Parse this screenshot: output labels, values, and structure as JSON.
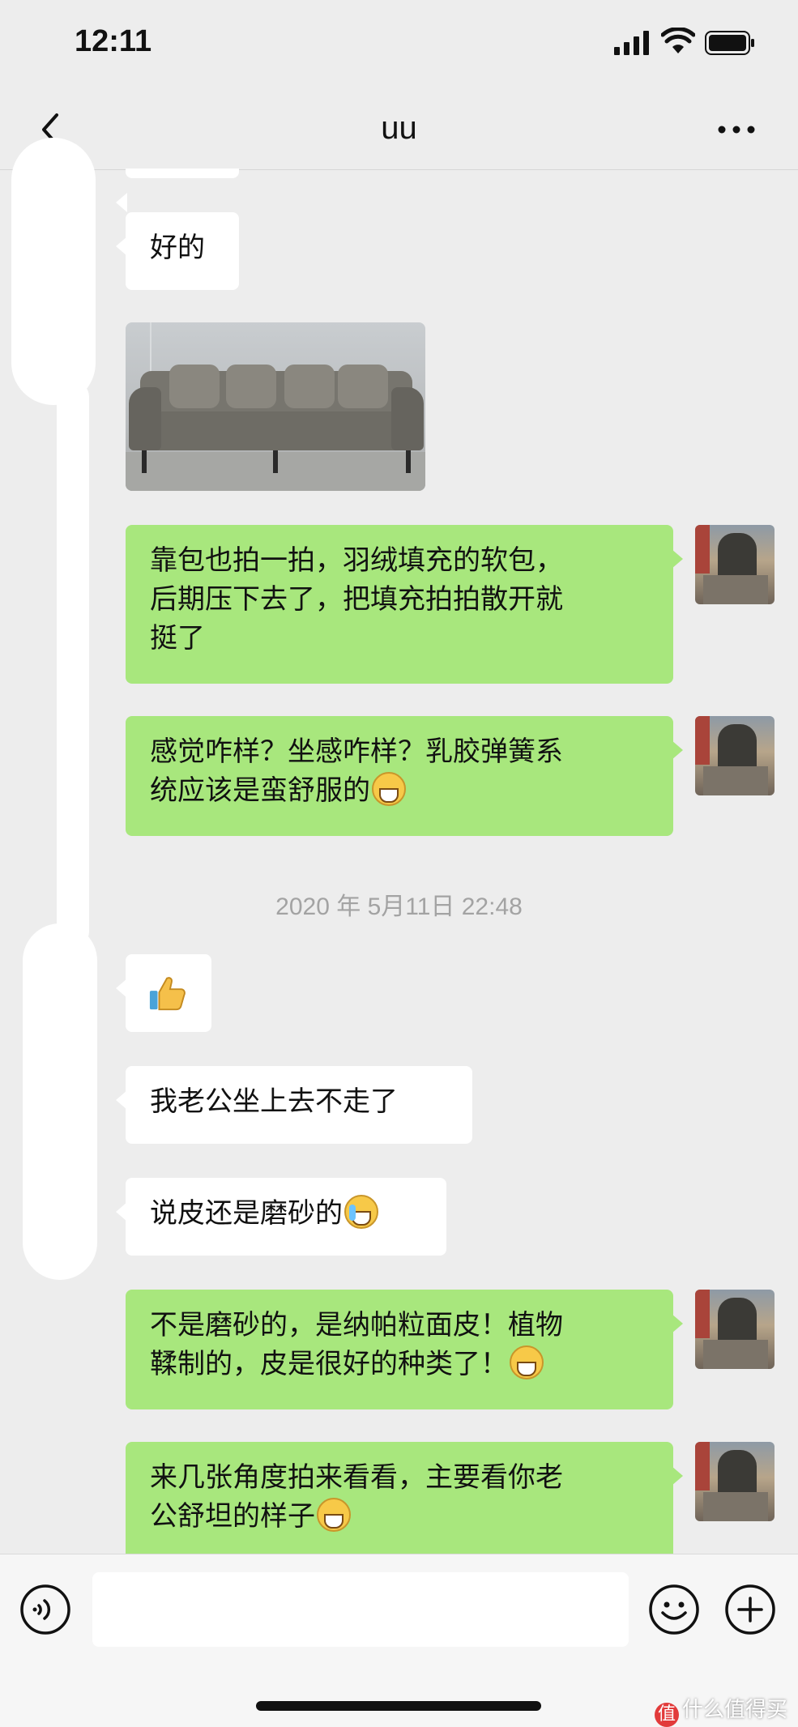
{
  "status_bar": {
    "time": "12:11"
  },
  "nav": {
    "title": "uu"
  },
  "messages": [
    {
      "side": "in",
      "text": "好的"
    },
    {
      "side": "in",
      "type": "image",
      "description": "sofa-photo"
    },
    {
      "side": "out",
      "lines": [
        "靠包也拍一拍，羽绒填充的软包，",
        "后期压下去了，把填充拍拍散开就",
        "挺了"
      ]
    },
    {
      "side": "out",
      "lines": [
        "感觉咋样？坐感咋样？乳胶弹簧系",
        "统应该是蛮舒服的"
      ]
    },
    {
      "side": "in",
      "type": "emoji",
      "description": "thumbs-up"
    },
    {
      "side": "in",
      "text": "我老公坐上去不走了"
    },
    {
      "side": "in",
      "text": "说皮还是磨砂的"
    },
    {
      "side": "out",
      "lines": [
        "不是磨砂的，是纳帕粒面皮！植物",
        "鞣制的，皮是很好的种类了！"
      ]
    },
    {
      "side": "out",
      "lines": [
        "来几张角度拍来看看，主要看你老",
        "公舒坦的样子"
      ]
    }
  ],
  "timestamp": "2020 年 5月11日  22:48",
  "watermark": "什么值得买",
  "watermark_badge": "值",
  "colors": {
    "bg": "#ededed",
    "out_bubble": "#a8e77d",
    "in_bubble": "#ffffff"
  }
}
